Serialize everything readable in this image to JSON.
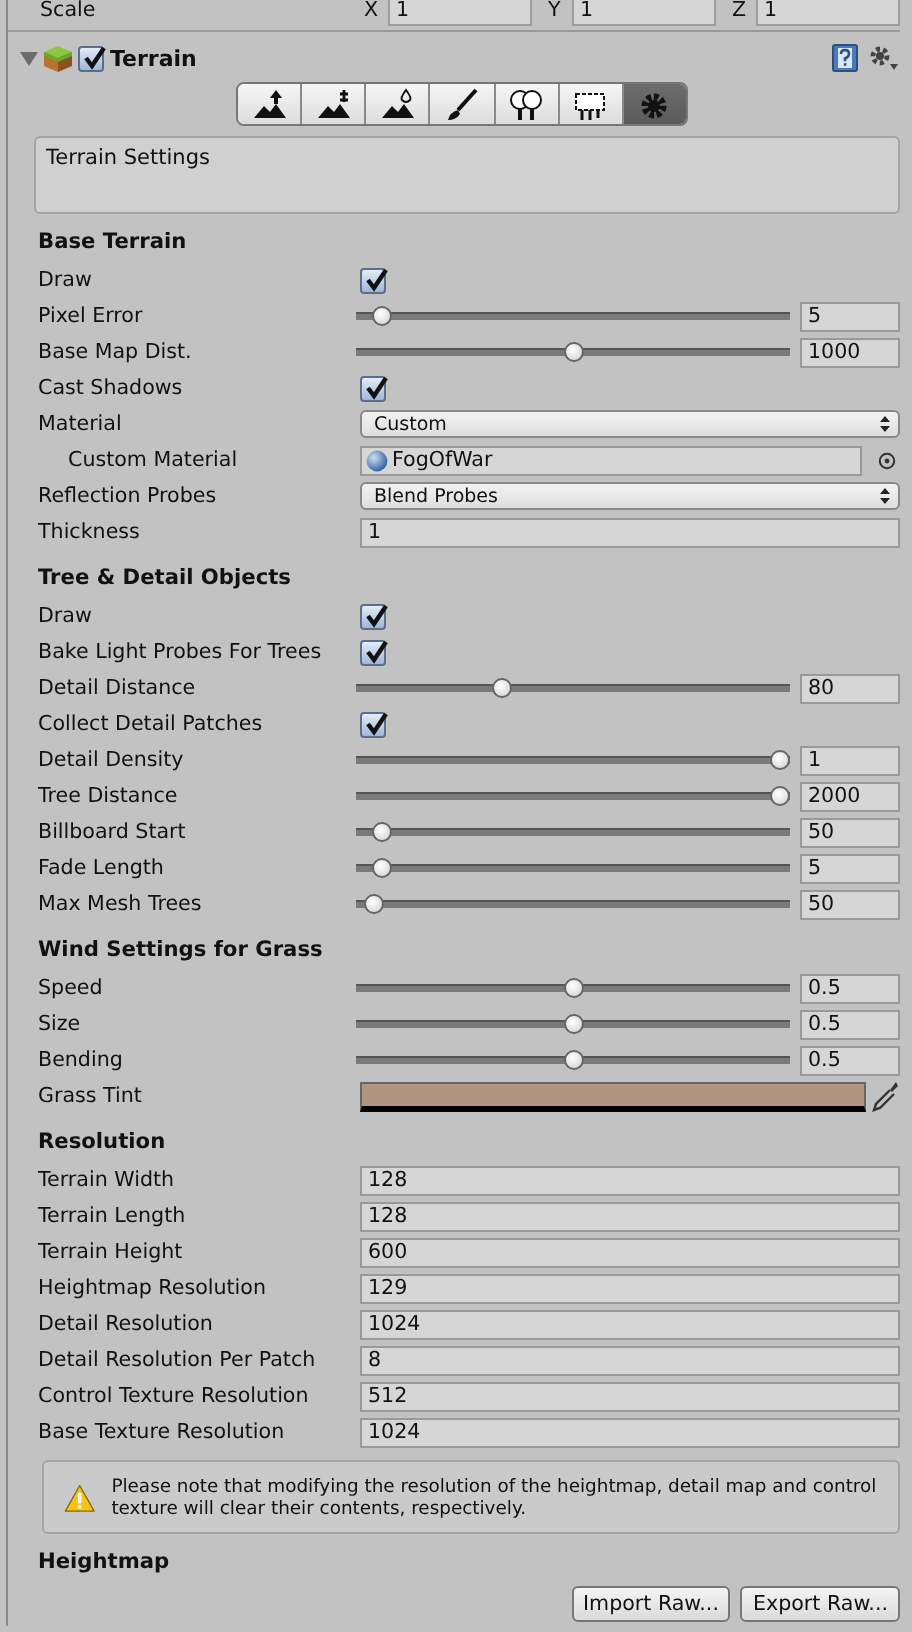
{
  "transform_row": {
    "label": "Scale",
    "axes": [
      {
        "axis": "X",
        "value": "1"
      },
      {
        "axis": "Y",
        "value": "1"
      },
      {
        "axis": "Z",
        "value": "1"
      }
    ]
  },
  "component": {
    "title": "Terrain",
    "expanded": true,
    "enabled": true
  },
  "tools": [
    {
      "kind": "raise",
      "selected": false
    },
    {
      "kind": "stamp",
      "selected": false
    },
    {
      "kind": "smooth",
      "selected": false
    },
    {
      "kind": "paint",
      "selected": false
    },
    {
      "kind": "trees",
      "selected": false
    },
    {
      "kind": "details",
      "selected": false
    },
    {
      "kind": "settings",
      "selected": true
    }
  ],
  "tool_description": "Terrain Settings",
  "sections": [
    {
      "title": "Base Terrain",
      "rows": [
        {
          "kind": "checkbox",
          "label": "Draw",
          "checked": true
        },
        {
          "kind": "slider",
          "label": "Pixel Error",
          "level": 0.04,
          "value": "5"
        },
        {
          "kind": "slider",
          "label": "Base Map Dist.",
          "level": 0.5,
          "value": "1000"
        },
        {
          "kind": "checkbox",
          "label": "Cast Shadows",
          "checked": true
        },
        {
          "kind": "dropdown",
          "label": "Material",
          "value": "Custom",
          "children": [
            {
              "kind": "object",
              "label": "Custom Material",
              "value": "FogOfWar"
            }
          ]
        },
        {
          "kind": "dropdown",
          "label": "Reflection Probes",
          "value": "Blend Probes"
        },
        {
          "kind": "text",
          "label": "Thickness",
          "value": "1"
        }
      ]
    },
    {
      "title": "Tree & Detail Objects",
      "rows": [
        {
          "kind": "checkbox",
          "label": "Draw",
          "checked": true
        },
        {
          "kind": "checkbox",
          "label": "Bake Light Probes For Trees",
          "checked": true
        },
        {
          "kind": "slider",
          "label": "Detail Distance",
          "level": 0.33,
          "value": "80"
        },
        {
          "kind": "checkbox",
          "label": "Collect Detail Patches",
          "checked": true
        },
        {
          "kind": "slider",
          "label": "Detail Density",
          "level": 1,
          "value": "1"
        },
        {
          "kind": "slider",
          "label": "Tree Distance",
          "level": 1,
          "value": "2000"
        },
        {
          "kind": "slider",
          "label": "Billboard Start",
          "level": 0.04,
          "value": "50"
        },
        {
          "kind": "slider",
          "label": "Fade Length",
          "level": 0.04,
          "value": "5"
        },
        {
          "kind": "slider",
          "label": "Max Mesh Trees",
          "level": 0.02,
          "value": "50"
        }
      ]
    },
    {
      "title": "Wind Settings for Grass",
      "rows": [
        {
          "kind": "slider",
          "label": "Speed",
          "level": 0.5,
          "value": "0.5"
        },
        {
          "kind": "slider",
          "label": "Size",
          "level": 0.5,
          "value": "0.5"
        },
        {
          "kind": "slider",
          "label": "Bending",
          "level": 0.5,
          "value": "0.5"
        },
        {
          "kind": "color",
          "label": "Grass Tint",
          "color": "#b09680"
        }
      ]
    },
    {
      "title": "Resolution",
      "rows": [
        {
          "kind": "text",
          "label": "Terrain Width",
          "value": "128"
        },
        {
          "kind": "text",
          "label": "Terrain Length",
          "value": "128"
        },
        {
          "kind": "text",
          "label": "Terrain Height",
          "value": "600"
        },
        {
          "kind": "text",
          "label": "Heightmap Resolution",
          "value": "129"
        },
        {
          "kind": "text",
          "label": "Detail Resolution",
          "value": "1024"
        },
        {
          "kind": "text",
          "label": "Detail Resolution Per Patch",
          "value": "8"
        },
        {
          "kind": "text",
          "label": "Control Texture Resolution",
          "value": "512"
        },
        {
          "kind": "text",
          "label": "Base Texture Resolution",
          "value": "1024"
        }
      ],
      "warning": "Please note that modifying the resolution of the heightmap, detail map and control texture will clear their contents, respectively."
    },
    {
      "title": "Heightmap",
      "buttons": [
        "Import Raw...",
        "Export Raw..."
      ]
    }
  ]
}
